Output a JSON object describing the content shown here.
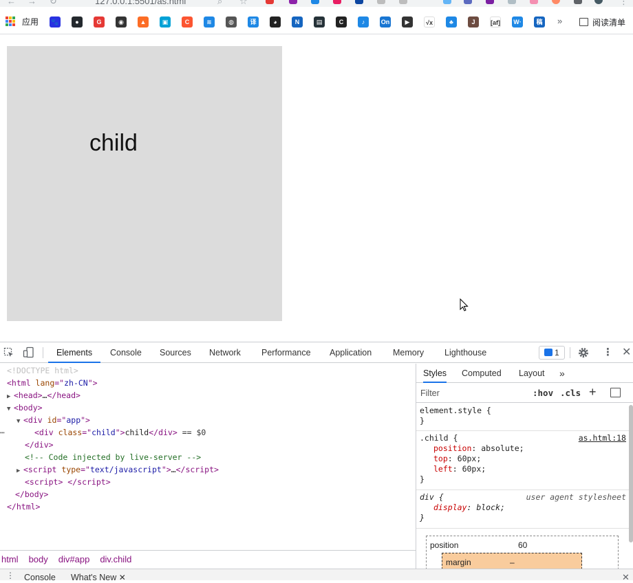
{
  "browser": {
    "url": "127.0.0.1:5501/as.html"
  },
  "bookmarks": {
    "apps_label": "应用",
    "items": [
      {
        "icon": "baidu-icon",
        "color": "#2932e1",
        "glyph": "🐾"
      },
      {
        "icon": "github-icon",
        "color": "#24292e",
        "glyph": "●"
      },
      {
        "icon": "g-icon",
        "color": "#e53935",
        "glyph": "G"
      },
      {
        "icon": "eye-icon",
        "color": "#333333",
        "glyph": "◉"
      },
      {
        "icon": "gitlab-icon",
        "color": "#fc6d26",
        "glyph": "▲"
      },
      {
        "icon": "bilibili-icon",
        "color": "#00a1d6",
        "glyph": "▣"
      },
      {
        "icon": "c-icon",
        "color": "#fc5531",
        "glyph": "C"
      },
      {
        "icon": "layers-icon",
        "color": "#1e88e5",
        "glyph": "≋"
      },
      {
        "icon": "globe-icon",
        "color": "#555555",
        "glyph": "◍"
      },
      {
        "icon": "translate-icon",
        "color": "#1e88e5",
        "glyph": "译"
      },
      {
        "icon": "panda-icon",
        "color": "#222222",
        "glyph": "◕"
      },
      {
        "icon": "n-icon",
        "color": "#1565c0",
        "glyph": "N"
      },
      {
        "icon": "terminal-icon",
        "color": "#263238",
        "glyph": "▤"
      },
      {
        "icon": "c-dark-icon",
        "color": "#222222",
        "glyph": "C"
      },
      {
        "icon": "bird-icon",
        "color": "#1e88e5",
        "glyph": "♪"
      },
      {
        "icon": "on-icon",
        "color": "#1976d2",
        "glyph": "On"
      },
      {
        "icon": "play-icon",
        "color": "#333333",
        "glyph": "▶"
      },
      {
        "icon": "sqrt-icon",
        "color": "#ffffff",
        "glyph": "√x"
      },
      {
        "icon": "leaf-icon",
        "color": "#1e88e5",
        "glyph": "♣"
      },
      {
        "icon": "j-icon",
        "color": "#6d4c41",
        "glyph": "J"
      },
      {
        "icon": "af-icon",
        "color": "#ffffff",
        "glyph": "[af]"
      },
      {
        "icon": "w-icon",
        "color": "#1e88e5",
        "glyph": "W·"
      },
      {
        "icon": "book-icon",
        "color": "#1565c0",
        "glyph": "稿"
      }
    ],
    "more": "»",
    "reading_list": "阅读清单"
  },
  "page": {
    "child_text": "child"
  },
  "devtools": {
    "tabs": [
      "Elements",
      "Console",
      "Sources",
      "Network",
      "Performance",
      "Application",
      "Memory",
      "Lighthouse"
    ],
    "active_tab": "Elements",
    "issues_count": "1",
    "dom": {
      "doctype": "<!DOCTYPE html>",
      "html_lang": "zh-CN",
      "head_collapsed": "…",
      "app_id": "app",
      "child_class": "child",
      "child_text": "child",
      "selected_marker": "== $0",
      "comment": "<!-- Code injected by live-server -->",
      "script_type": "text/javascript",
      "script_collapsed": "…"
    },
    "breadcrumb": [
      "html",
      "body",
      "div#app",
      "div.child"
    ],
    "drawer": {
      "tabs": [
        "Console",
        "What's New"
      ]
    },
    "styles": {
      "tabs": [
        "Styles",
        "Computed",
        "Layout"
      ],
      "active_tab": "Styles",
      "filter_placeholder": "Filter",
      "hov": ":hov",
      "cls": ".cls",
      "element_style": "element.style {",
      "close_brace": "}",
      "child_rule": {
        "selector": ".child {",
        "source": "as.html:18",
        "props": [
          {
            "name": "position",
            "value": "absolute;"
          },
          {
            "name": "top",
            "value": "60px;"
          },
          {
            "name": "left",
            "value": "60px;"
          }
        ]
      },
      "ua_rule": {
        "selector": "div {",
        "source": "user agent stylesheet",
        "props": [
          {
            "name": "display",
            "value": "block;"
          }
        ]
      },
      "box_model": {
        "position_label": "position",
        "position_value": "60",
        "margin_label": "margin",
        "margin_value": "–"
      }
    }
  }
}
